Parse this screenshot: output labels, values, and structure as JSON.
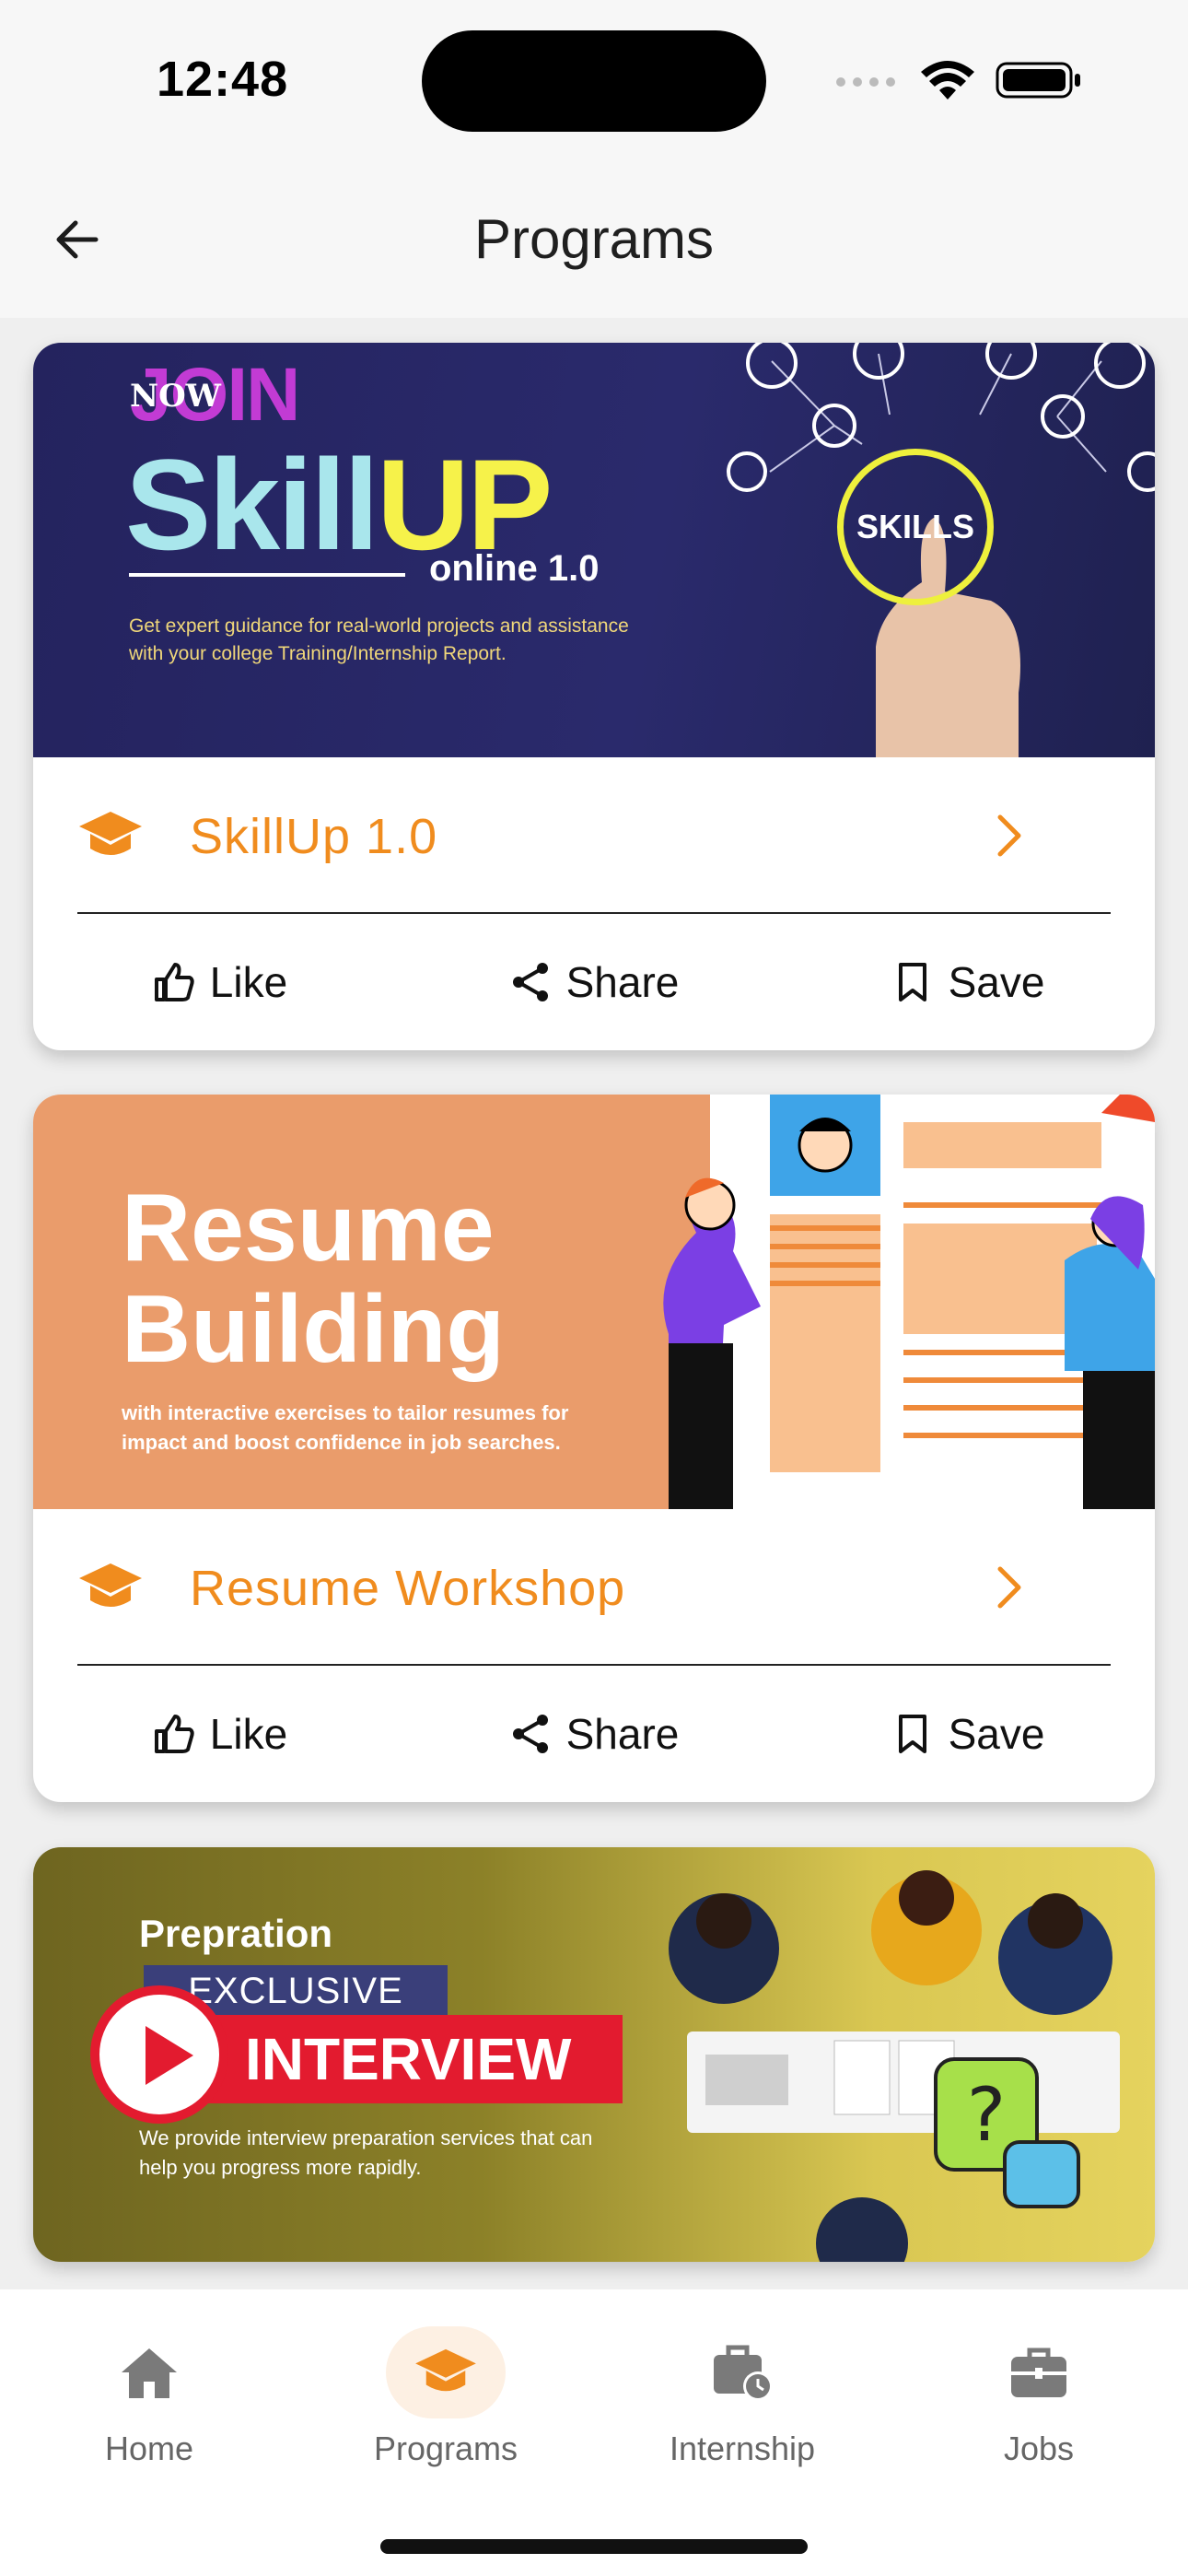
{
  "status_bar": {
    "time": "12:48"
  },
  "header": {
    "title": "Programs"
  },
  "cards": [
    {
      "title": "SkillUp 1.0",
      "banner": {
        "join": "JOIN",
        "now": "NOW",
        "skill": "Skill",
        "up": "UP",
        "online": "online 1.0",
        "desc": "Get expert guidance for real-world projects and assistance with your college Training/Internship Report.",
        "badge": "SKILLS"
      },
      "like": "Like",
      "share": "Share",
      "save": "Save"
    },
    {
      "title": "Resume Workshop",
      "banner": {
        "line1": "Resume",
        "line2": "Building",
        "desc": "with interactive exercises to tailor resumes for impact and boost confidence in job searches."
      },
      "like": "Like",
      "share": "Share",
      "save": "Save"
    },
    {
      "banner": {
        "prep": "Prepration",
        "excl": "EXCLUSIVE",
        "inter": "INTERVIEW",
        "desc": "We provide interview preparation services that can help you progress more rapidly."
      }
    }
  ],
  "nav": {
    "items": [
      {
        "label": "Home",
        "icon": "home-icon"
      },
      {
        "label": "Programs",
        "icon": "graduation-cap-icon",
        "active": true
      },
      {
        "label": "Internship",
        "icon": "briefcase-clock-icon"
      },
      {
        "label": "Jobs",
        "icon": "briefcase-icon"
      }
    ]
  },
  "colors": {
    "accent": "#f08c1e",
    "nav_inactive": "#7a7a7a",
    "active_pill": "#fdf0e3"
  }
}
